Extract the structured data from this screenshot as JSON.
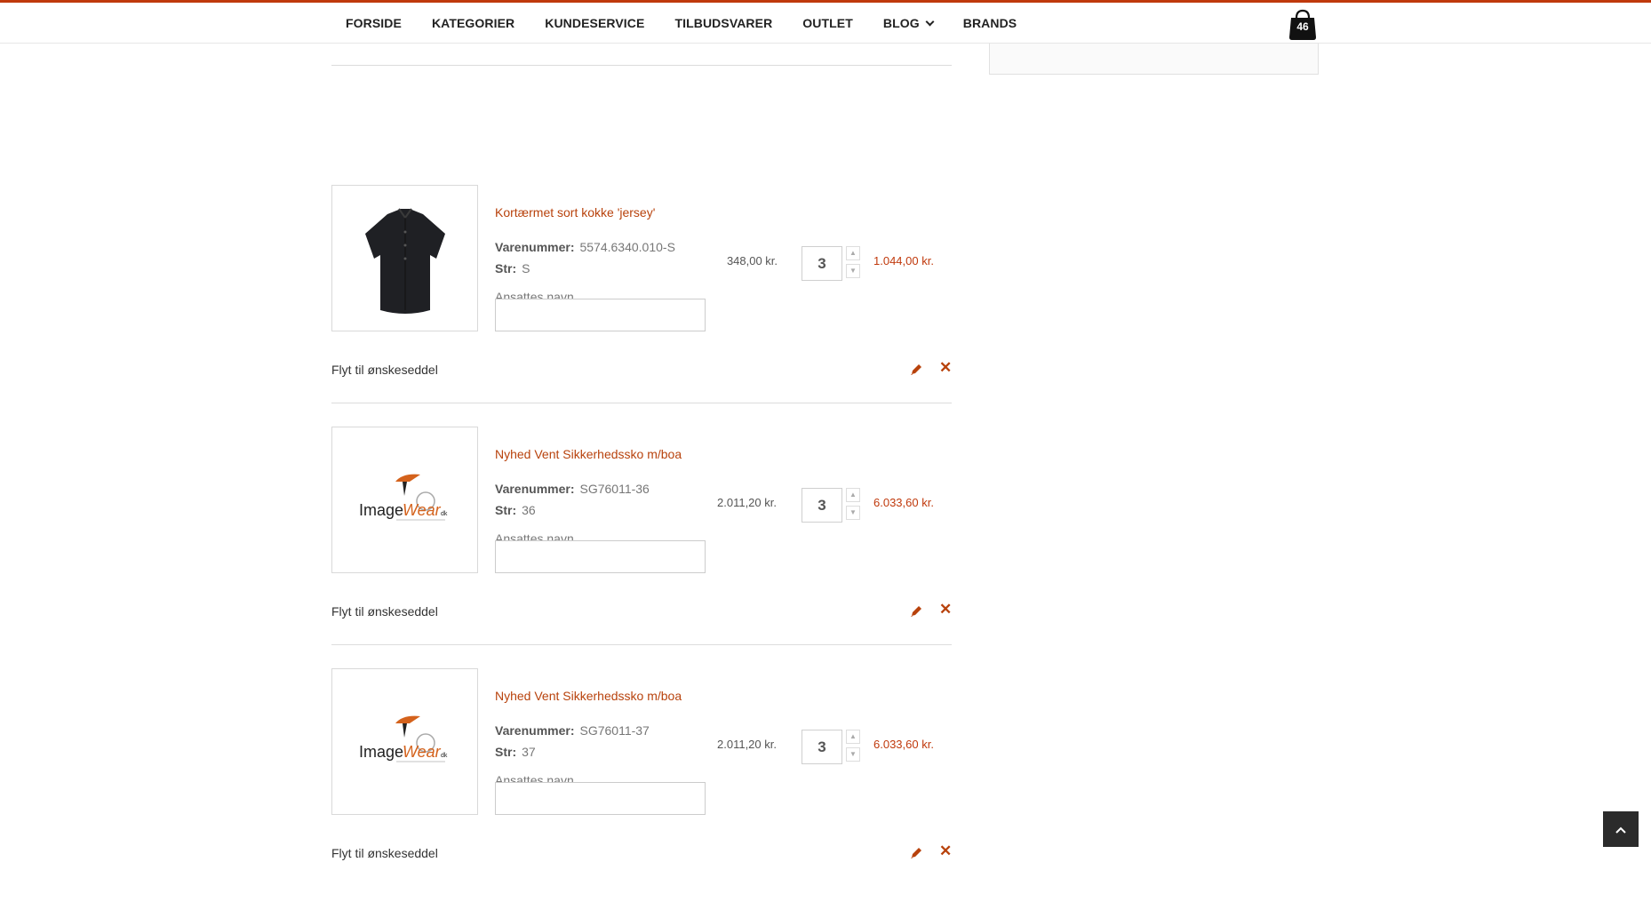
{
  "nav": {
    "items": [
      "FORSIDE",
      "KATEGORIER",
      "KUNDESERVICE",
      "TILBUDSVARER",
      "OUTLET",
      "BLOG",
      "BRANDS"
    ]
  },
  "cart": {
    "count": "46",
    "icon": "shopping-bag-icon"
  },
  "labels": {
    "sku": "Varenummer:",
    "size": "Str:",
    "employee_name": "Ansattes navn",
    "wishlist": "Flyt til ønskeseddel"
  },
  "items": [
    {
      "name": "",
      "sku": "",
      "size": "",
      "price": "",
      "qty": "",
      "subtotal": "",
      "image": "black-shirt"
    },
    {
      "name": "Kortærmet sort kokke 'jersey'",
      "sku": "5574.6340.010-S",
      "size": "S",
      "price": "348,00 kr.",
      "qty": "3",
      "subtotal": "1.044,00 kr.",
      "image": "black-shirt"
    },
    {
      "name": "Nyhed Vent Sikkerhedssko m/boa",
      "sku": "SG76011-36",
      "size": "36",
      "price": "2.011,20 kr.",
      "qty": "3",
      "subtotal": "6.033,60 kr.",
      "image": "imagewear-logo"
    },
    {
      "name": "Nyhed Vent Sikkerhedssko m/boa",
      "sku": "SG76011-37",
      "size": "37",
      "price": "2.011,20 kr.",
      "qty": "3",
      "subtotal": "6.033,60 kr.",
      "image": "imagewear-logo"
    }
  ],
  "logo": {
    "text_a": "Image",
    "text_b": "Wear",
    "suffix": "dk"
  },
  "colors": {
    "accent": "#c0390c",
    "link": "#b8420c",
    "dark": "#222222"
  }
}
